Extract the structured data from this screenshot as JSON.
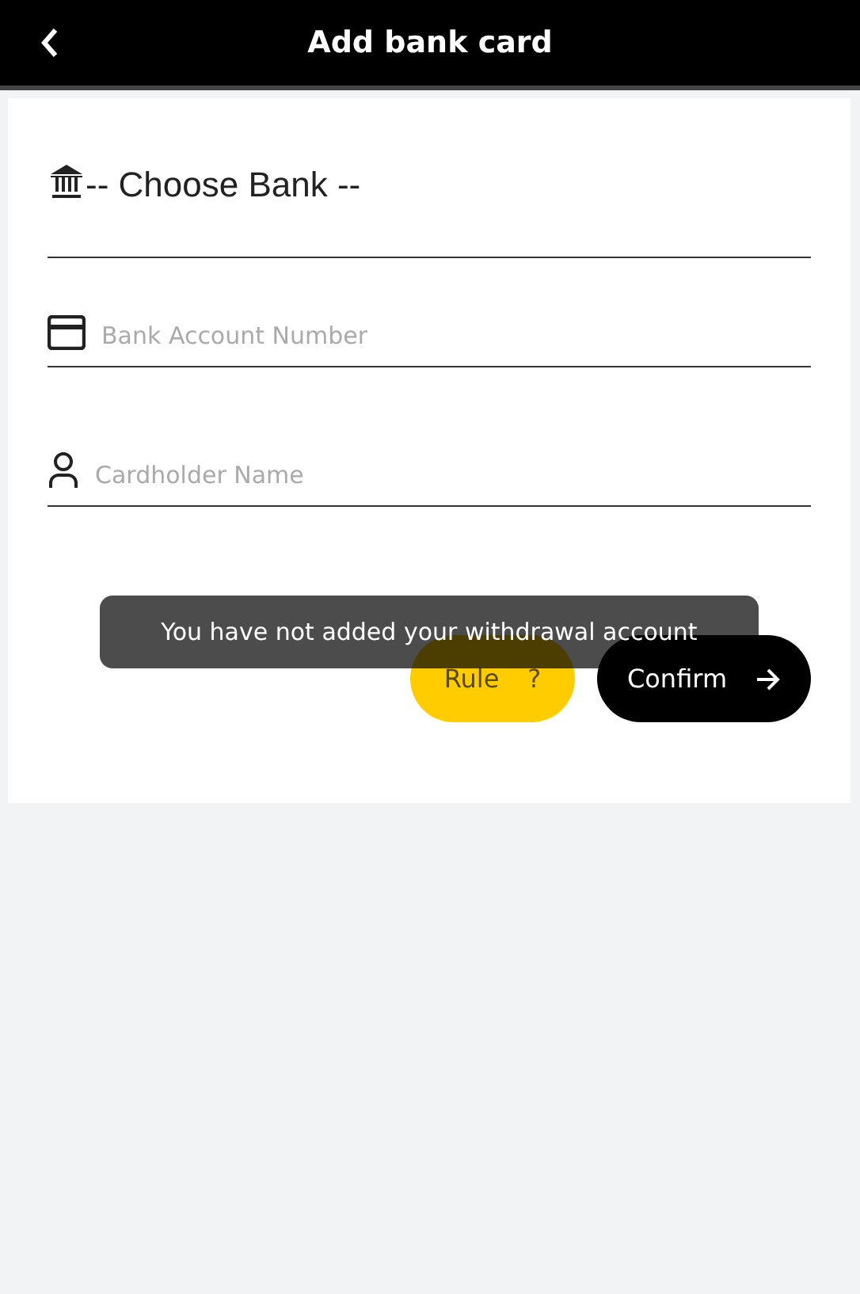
{
  "header": {
    "title": "Add bank card"
  },
  "fields": [
    {
      "kind": "select",
      "value": "-- Choose Bank --"
    },
    {
      "kind": "card",
      "placeholder": "Bank Account Number"
    },
    {
      "kind": "person",
      "placeholder": "Cardholder Name"
    }
  ],
  "buttons": {
    "rule": {
      "label": "Rule",
      "icon_text": "?"
    },
    "confirm": {
      "label": "Confirm"
    }
  },
  "toast": "You have not added your withdrawal account"
}
